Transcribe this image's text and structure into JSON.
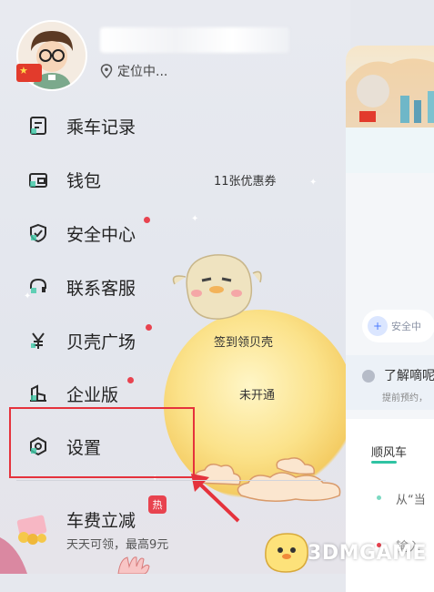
{
  "profile": {
    "location_text": "定位中..."
  },
  "menu": {
    "items": [
      {
        "label": "乘车记录",
        "sub": ""
      },
      {
        "label": "钱包",
        "sub": "11张优惠券"
      },
      {
        "label": "安全中心",
        "sub": ""
      },
      {
        "label": "联系客服",
        "sub": ""
      },
      {
        "label": "贝壳广场",
        "sub": "签到领贝壳"
      },
      {
        "label": "企业版",
        "sub": "未开通"
      },
      {
        "label": "设置",
        "sub": ""
      }
    ]
  },
  "promo": {
    "title": "车费立减",
    "subtitle": "天天可领，最高9元",
    "badge": "热"
  },
  "main_panel": {
    "safety_label": "安全中",
    "learn_title": "了解嘀呢",
    "learn_sub": "提前预约，",
    "card_title": "顺风车",
    "from_text": "从“当",
    "input_text": "输入"
  },
  "watermark": "3DMGAME",
  "colors": {
    "accent_red": "#e5323c",
    "teal": "#2fc3a3",
    "badge_red": "#e8434f"
  }
}
